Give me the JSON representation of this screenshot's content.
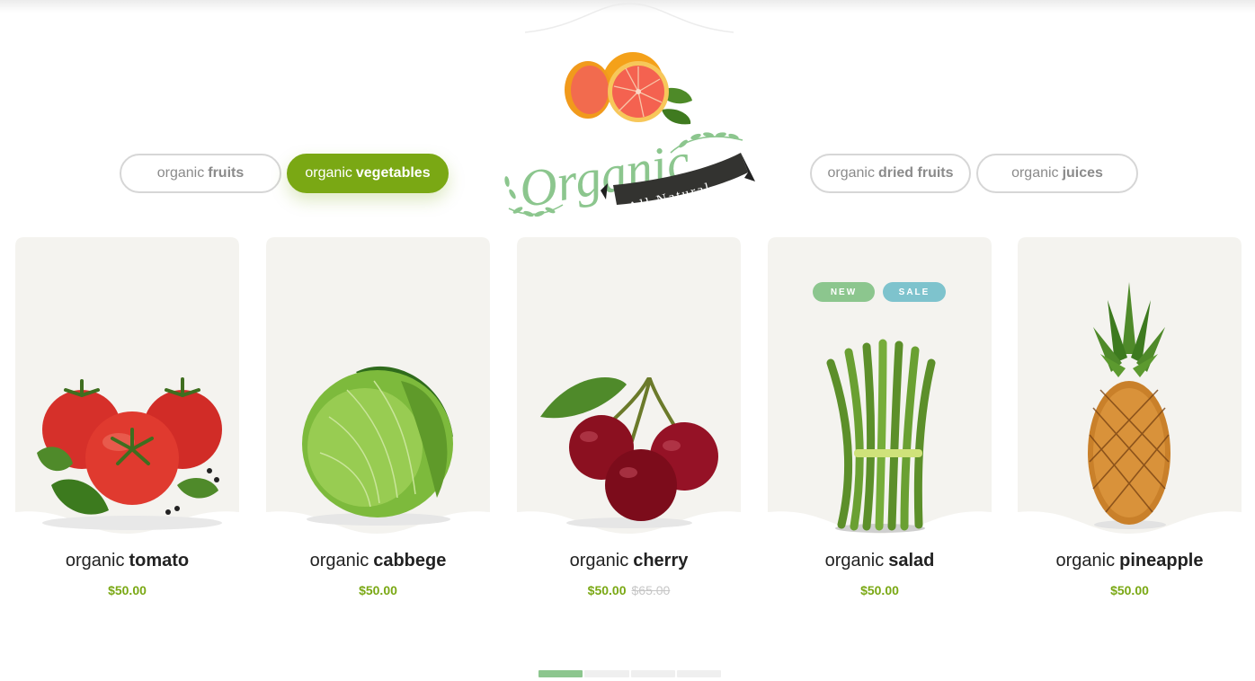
{
  "tabs": [
    {
      "prefix": "organic",
      "name": "fruits",
      "active": false
    },
    {
      "prefix": "organic",
      "name": "vegetables",
      "active": true
    },
    {
      "prefix": "organic",
      "name": "dried fruits",
      "active": false
    },
    {
      "prefix": "organic",
      "name": "juices",
      "active": false
    }
  ],
  "logo": {
    "title": "Organic",
    "ribbon": "All Natural"
  },
  "products": [
    {
      "prefix": "organic",
      "name": "tomato",
      "price": "$50.00",
      "old_price": "",
      "image": "tomato-image"
    },
    {
      "prefix": "organic",
      "name": "cabbege",
      "price": "$50.00",
      "old_price": "",
      "image": "cabbage-image"
    },
    {
      "prefix": "organic",
      "name": "cherry",
      "price": "$50.00",
      "old_price": "$65.00",
      "image": "cherry-image"
    },
    {
      "prefix": "organic",
      "name": "salad",
      "price": "$50.00",
      "old_price": "",
      "image": "asparagus-image",
      "badges": [
        {
          "label": "NEW",
          "color": "#8cc68e"
        },
        {
          "label": "SALE",
          "color": "#7ec3cd"
        }
      ]
    },
    {
      "prefix": "organic",
      "name": "pineapple",
      "price": "$50.00",
      "old_price": "",
      "image": "pineapple-image"
    }
  ],
  "pagination": {
    "pages": 4,
    "current": 1
  },
  "colors": {
    "accent": "#7aa814",
    "card_bg": "#f4f3ef",
    "new_badge": "#8cc68e",
    "sale_badge": "#7ec3cd"
  }
}
